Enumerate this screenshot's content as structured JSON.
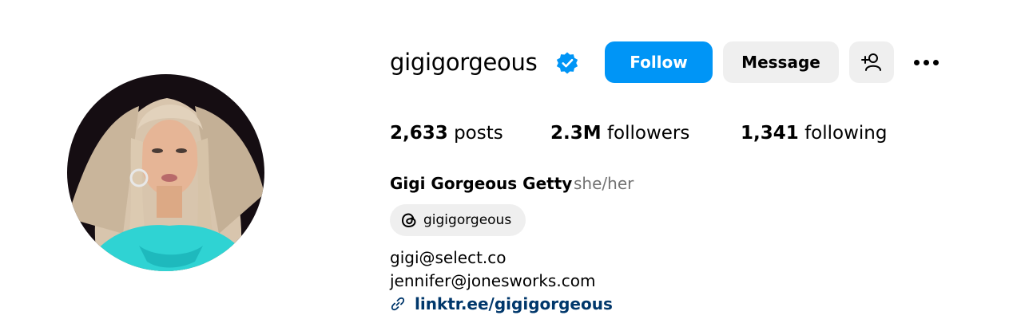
{
  "profile": {
    "username": "gigigorgeous",
    "verified": true,
    "full_name": "Gigi Gorgeous Getty",
    "pronouns": "she/her",
    "threads_handle": "gigigorgeous",
    "bio_lines": [
      "gigi@select.co",
      "jennifer@jonesworks.com"
    ],
    "link": "linktr.ee/gigigorgeous"
  },
  "actions": {
    "follow_label": "Follow",
    "message_label": "Message",
    "suggest_icon": "person-add-icon",
    "more_icon": "more-options-icon"
  },
  "stats": {
    "posts_count": "2,633",
    "posts_label": "posts",
    "followers_count": "2.3M",
    "followers_label": "followers",
    "following_count": "1,341",
    "following_label": "following"
  },
  "colors": {
    "accent": "#0095f6",
    "verified": "#0095f6",
    "button_secondary": "#efefef",
    "link": "#00376b",
    "muted": "#737373"
  }
}
